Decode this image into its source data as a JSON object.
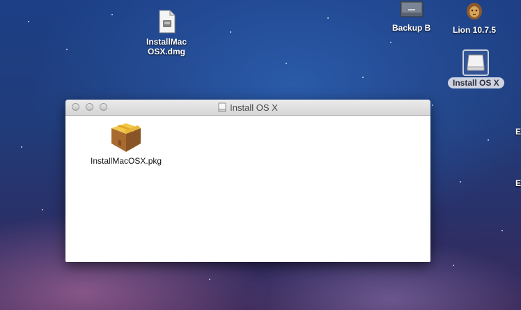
{
  "desktop": {
    "icons": [
      {
        "label_line1": "InstallMac",
        "label_line2": "OSX.dmg"
      },
      {
        "label": "Backup B"
      },
      {
        "label": "Lion 10.7.5"
      },
      {
        "label": "Install OS X"
      }
    ],
    "edge_letters": [
      "E",
      "E"
    ]
  },
  "window": {
    "title": "Install OS X",
    "items": [
      {
        "label": "InstallMacOSX.pkg",
        "icon": "package-icon"
      }
    ]
  }
}
